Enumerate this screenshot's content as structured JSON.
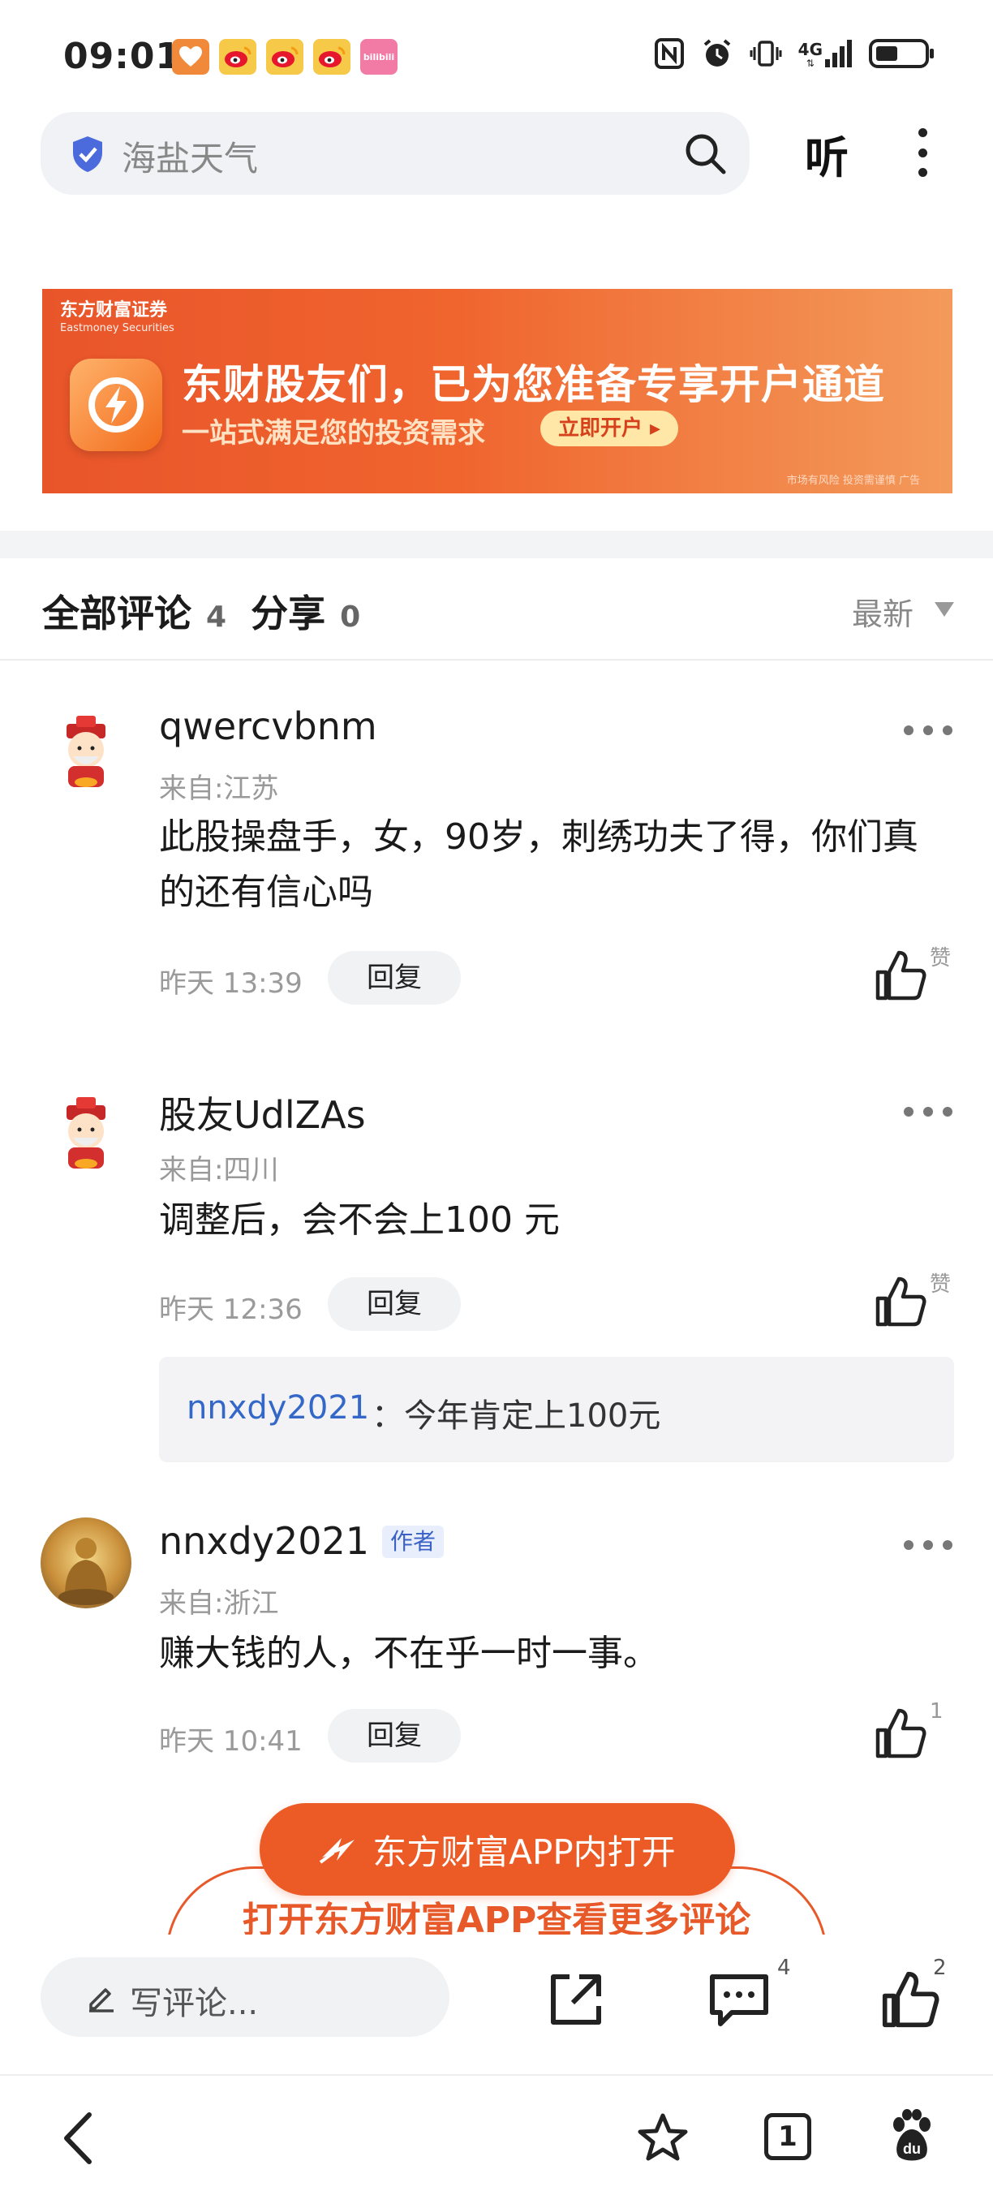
{
  "status_bar": {
    "time": "09:01",
    "network": "4G",
    "notification_icons": [
      "health-app-icon",
      "weibo-icon",
      "weibo-icon",
      "weibo-icon",
      "bilibili-icon"
    ],
    "bilibili_label": "bilibili"
  },
  "search": {
    "query": "海盐天气",
    "listen_label": "听"
  },
  "peek_text": "",
  "ad": {
    "brand": "东方财富证券",
    "brand_en": "Eastmoney Securities",
    "headline": "东财股友们，已为您准备专享开户通道",
    "subline": "一站式满足您的投资需求",
    "cta": "立即开户 ▸",
    "note": "市场有风险 投资需谨慎  广告"
  },
  "comments_header": {
    "all_label": "全部评论",
    "all_count": "4",
    "share_label": "分享",
    "share_count": "0",
    "sort_label": "最新"
  },
  "comments": [
    {
      "user": "qwercvbnm",
      "location": "来自:江苏",
      "text": "此股操盘手，女，90岁，刺绣功夫了得，你们真的还有信心吗",
      "time": "昨天 13:39",
      "reply_label": "回复",
      "like_label": "赞"
    },
    {
      "user": "股友UdlZAs",
      "location": "来自:四川",
      "text": "调整后，会不会上100 元",
      "time": "昨天 12:36",
      "reply_label": "回复",
      "like_label": "赞",
      "sub_reply": {
        "user": "nnxdy2021",
        "text": "：今年肯定上100元"
      }
    },
    {
      "user": "nnxdy2021",
      "author_tag": "作者",
      "location": "来自:浙江",
      "text": "赚大钱的人，不在乎一时一事。",
      "time": "昨天 10:41",
      "reply_label": "回复",
      "like_label": "1"
    }
  ],
  "open_app": {
    "button_label": "东方财富APP内打开",
    "more_label": "打开东方财富APP查看更多评论"
  },
  "bottom_bar": {
    "write_placeholder": "写评论...",
    "comment_count": "4",
    "like_count": "2"
  },
  "browser_nav": {
    "tabs_count": "1"
  },
  "colors": {
    "accent": "#ec5b26",
    "link": "#3367c8",
    "ad_bg": "#ee5f2c"
  }
}
